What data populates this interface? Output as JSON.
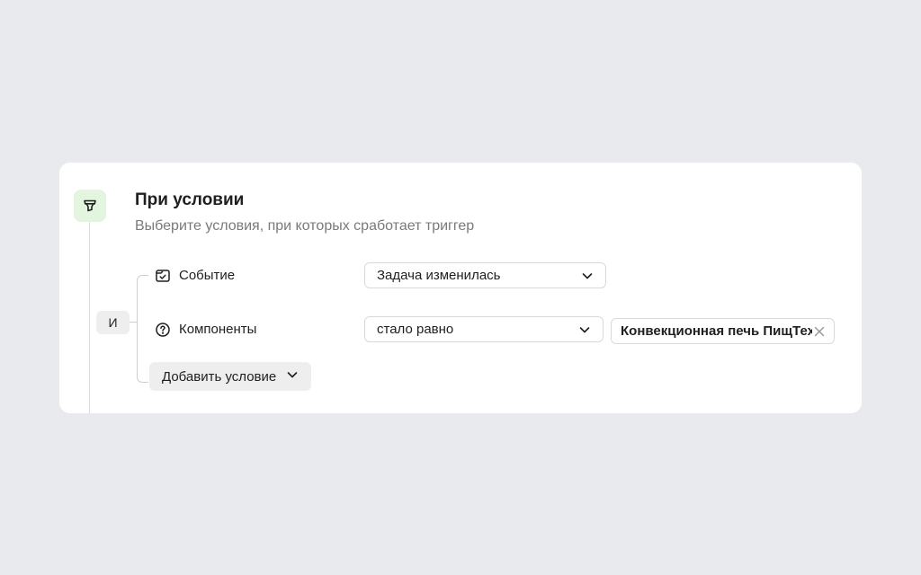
{
  "section": {
    "title": "При условии",
    "subtitle": "Выберите условия, при которых сработает триггер",
    "operator": "И",
    "icon": "filter-icon",
    "accent_bg": "#e3f5df"
  },
  "conditions": [
    {
      "label": "Событие",
      "icon": "calendar-check-icon",
      "select_value": "Задача изменилась"
    },
    {
      "label": "Компоненты",
      "icon": "question-circle-icon",
      "select_value": "стало равно",
      "token_value": "Конвекционная печь ПищТех"
    }
  ],
  "add_button": {
    "label": "Добавить условие"
  }
}
